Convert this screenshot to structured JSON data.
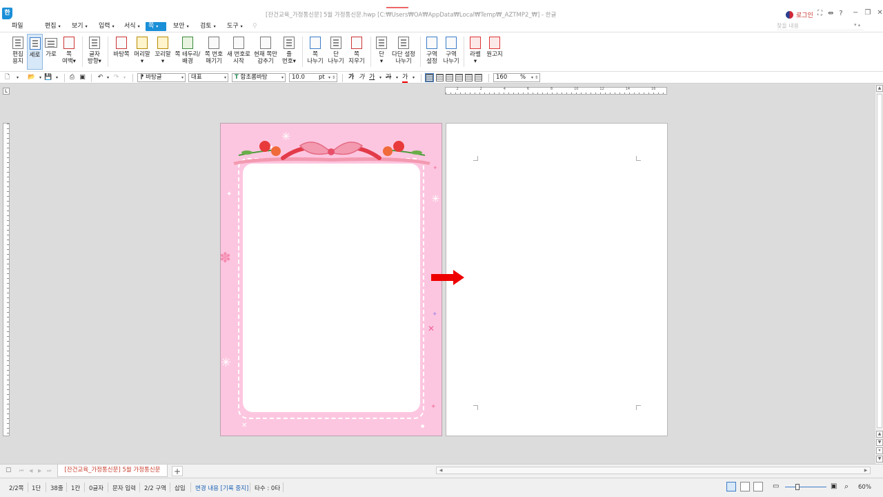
{
  "window": {
    "title": "[잔건교육_가정통신문] 5월 가정통신문.hwp [C:₩Users₩OA₩AppData₩Local₩Temp₩_AZTMP2_₩] - 한글",
    "app_logo": "한",
    "login": "로그인"
  },
  "menu": [
    {
      "label": "파일",
      "arrow": ""
    },
    {
      "label": "편집",
      "arrow": "▾"
    },
    {
      "label": "보기",
      "arrow": "▾"
    },
    {
      "label": "입력",
      "arrow": "▾"
    },
    {
      "label": "서식",
      "arrow": "▾"
    },
    {
      "label": "쪽",
      "arrow": "▾",
      "active": true
    },
    {
      "label": "보안",
      "arrow": "▾"
    },
    {
      "label": "검토",
      "arrow": "▾"
    },
    {
      "label": "도구",
      "arrow": "▾"
    }
  ],
  "search": {
    "placeholder": "찾을 내용"
  },
  "ribbon": {
    "edit_paper": [
      "편집",
      "용지"
    ],
    "portrait": "세로",
    "landscape": "가로",
    "margins": [
      "쪽",
      "여백▾"
    ],
    "text_dir": [
      "글자",
      "방향▾"
    ],
    "background": "바탕쪽",
    "header": [
      "머리말",
      "▾"
    ],
    "footer": [
      "꼬리말",
      "▾"
    ],
    "border": [
      "쪽 테두리/",
      "배경"
    ],
    "page_num": [
      "쪽 번호",
      "매기기"
    ],
    "new_num": [
      "새 번호로",
      "시작"
    ],
    "hide_page": [
      "현재 쪽만",
      "감추기"
    ],
    "line_num": [
      "줄",
      "번호▾"
    ],
    "page_break": [
      "쪽",
      "나누기"
    ],
    "col_break": [
      "단",
      "나누기"
    ],
    "delete_page": [
      "쪽",
      "지우기"
    ],
    "columns": [
      "단",
      "▾"
    ],
    "multi_col": [
      "다단 설정",
      "나누기"
    ],
    "section_set": [
      "구역",
      "설정"
    ],
    "section_break": [
      "구역",
      "나누기"
    ],
    "label": [
      "라벨",
      "▾"
    ],
    "manuscript": "원고지"
  },
  "format": {
    "style": "바탕글",
    "lang": "대표",
    "font": "함초롬바탕",
    "font_prefix": "T",
    "size": "10.0",
    "size_unit": "pt",
    "bold": "가",
    "italic": "가",
    "underline": "가",
    "strike": "가",
    "color": "가",
    "zoom": "160",
    "zoom_unit": "%"
  },
  "ruler": {
    "ticks": [
      "2",
      "2",
      "4",
      "6",
      "8",
      "10",
      "12",
      "14",
      "16"
    ]
  },
  "tabs": {
    "document": "[잔건교육_가정통신문] 5월 가정통신문",
    "add": "+"
  },
  "status": {
    "page": "2/2쪽",
    "column": "1단",
    "line": "38줄",
    "char_col": "1칸",
    "chars": "0글자",
    "input_mode": "문자 입력",
    "section": "2/2 구역",
    "insert": "삽입",
    "track_changes": "변경 내용 [기록 중지]",
    "typing_speed": "타수 : 0타",
    "zoom": "60%"
  },
  "colors": {
    "accent": "#1a8fd8",
    "stationery_bg": "#fdc6e0",
    "arrow": "#ee0000",
    "tab_text": "#c83c2c"
  }
}
